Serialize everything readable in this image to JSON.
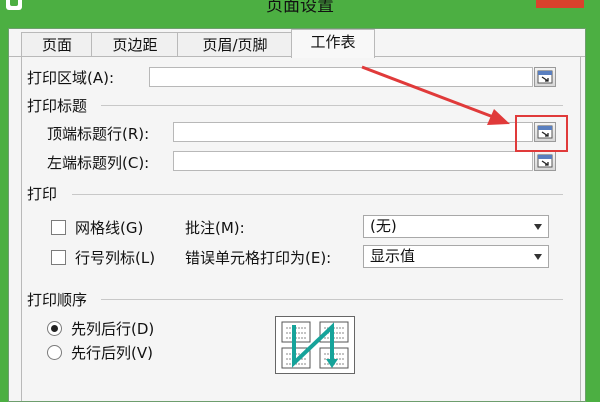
{
  "window": {
    "title": "页面设置"
  },
  "tabs": [
    {
      "label": "页面"
    },
    {
      "label": "页边距"
    },
    {
      "label": "页眉/页脚"
    },
    {
      "label": "工作表"
    }
  ],
  "print_area": {
    "label": "打印区域(A):",
    "value": ""
  },
  "print_titles": {
    "section_label": "打印标题",
    "top_rows_label": "顶端标题行(R):",
    "top_rows_value": "",
    "left_cols_label": "左端标题列(C):",
    "left_cols_value": ""
  },
  "print": {
    "section_label": "打印",
    "gridlines_label": "网格线(G)",
    "gridlines_checked": false,
    "headings_label": "行号列标(L)",
    "headings_checked": false,
    "comments_label": "批注(M):",
    "comments_value": "(无)",
    "errors_label": "错误单元格打印为(E):",
    "errors_value": "显示值"
  },
  "page_order": {
    "section_label": "打印顺序",
    "down_then_over_label": "先列后行(D)",
    "over_then_down_label": "先行后列(V)",
    "selected": "down_then_over"
  },
  "colors": {
    "titlebar": "#4caf42",
    "annotation": "#e03a3a",
    "diagram_arrow": "#16a39a"
  },
  "icons": [
    "app-icon",
    "close-icon",
    "range-picker-icon",
    "dropdown-arrow-icon",
    "page-order-diagram"
  ]
}
